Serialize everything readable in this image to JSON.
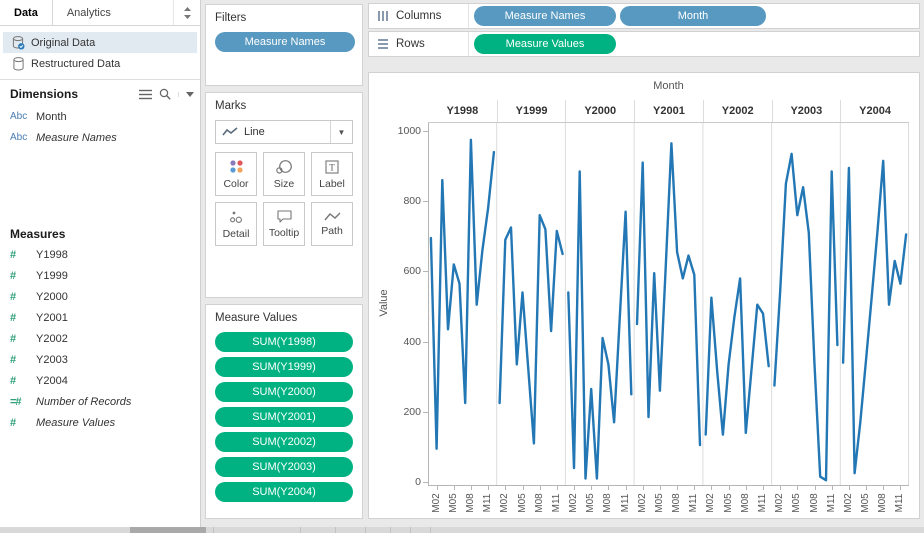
{
  "sidebar": {
    "tabs": [
      {
        "label": "Data"
      },
      {
        "label": "Analytics"
      }
    ],
    "data_sources": [
      {
        "label": "Original Data",
        "selected": true
      },
      {
        "label": "Restructured Data",
        "selected": false
      }
    ],
    "dimensions": {
      "header": "Dimensions",
      "items": [
        {
          "prefix": "Abc",
          "label": "Month",
          "italic": false
        },
        {
          "prefix": "Abc",
          "label": "Measure Names",
          "italic": true
        }
      ]
    },
    "measures": {
      "header": "Measures",
      "items": [
        {
          "icon": "#",
          "label": "Y1998",
          "italic": false
        },
        {
          "icon": "#",
          "label": "Y1999",
          "italic": false
        },
        {
          "icon": "#",
          "label": "Y2000",
          "italic": false
        },
        {
          "icon": "#",
          "label": "Y2001",
          "italic": false
        },
        {
          "icon": "#",
          "label": "Y2002",
          "italic": false
        },
        {
          "icon": "#",
          "label": "Y2003",
          "italic": false
        },
        {
          "icon": "#",
          "label": "Y2004",
          "italic": false
        },
        {
          "icon": "=#",
          "label": "Number of Records",
          "italic": true
        },
        {
          "icon": "#",
          "label": "Measure Values",
          "italic": true
        }
      ]
    }
  },
  "filters_card": {
    "title": "Filters",
    "pills": [
      "Measure Names"
    ]
  },
  "marks_card": {
    "title": "Marks",
    "mark_type": "Line",
    "buttons": [
      {
        "label": "Color"
      },
      {
        "label": "Size"
      },
      {
        "label": "Label"
      },
      {
        "label": "Detail"
      },
      {
        "label": "Tooltip"
      },
      {
        "label": "Path"
      }
    ]
  },
  "measure_values_card": {
    "title": "Measure Values",
    "pills": [
      "SUM(Y1998)",
      "SUM(Y1999)",
      "SUM(Y2000)",
      "SUM(Y2001)",
      "SUM(Y2002)",
      "SUM(Y2003)",
      "SUM(Y2004)"
    ]
  },
  "shelves": {
    "columns": {
      "label": "Columns",
      "pills": [
        "Measure Names",
        "Month"
      ]
    },
    "rows": {
      "label": "Rows",
      "pills": [
        "Measure Values"
      ]
    }
  },
  "colors": {
    "dimension_pill_blue": "#5799c0",
    "measure_pill_green": "#00b281",
    "line_blue": "#2277b4",
    "selected_row": "#e2eaf1",
    "field_number_icon_green": "#2e9e7a",
    "abc_prefix_blue": "#4a7cb0"
  },
  "chart_data": {
    "type": "line",
    "title": "Month",
    "ylabel": "Value",
    "ylim": [
      0,
      1000
    ],
    "yticks": [
      0,
      200,
      400,
      600,
      800,
      1000
    ],
    "grid": "off",
    "legend": "none",
    "line_color": "#2277b4",
    "panels": [
      "Y1998",
      "Y1999",
      "Y2000",
      "Y2001",
      "Y2002",
      "Y2003",
      "Y2004"
    ],
    "x_categories": [
      "M01",
      "M02",
      "M03",
      "M04",
      "M05",
      "M06",
      "M07",
      "M08",
      "M09",
      "M10",
      "M11",
      "M12"
    ],
    "x_tick_labels": [
      "M02",
      "M05",
      "M08",
      "M11"
    ],
    "x_tick_months": [
      2,
      5,
      8,
      11
    ],
    "series": [
      {
        "name": "Y1998",
        "values": [
          695,
          95,
          860,
          435,
          620,
          565,
          225,
          975,
          505,
          660,
          780,
          940
        ]
      },
      {
        "name": "Y1999",
        "values": [
          225,
          690,
          725,
          335,
          540,
          325,
          110,
          760,
          720,
          430,
          715,
          650
        ]
      },
      {
        "name": "Y2000",
        "values": [
          540,
          40,
          885,
          10,
          265,
          10,
          410,
          335,
          170,
          470,
          770,
          250
        ]
      },
      {
        "name": "Y2001",
        "values": [
          450,
          910,
          185,
          595,
          260,
          605,
          965,
          655,
          580,
          645,
          590,
          105
        ]
      },
      {
        "name": "Y2002",
        "values": [
          135,
          525,
          315,
          135,
          335,
          470,
          580,
          140,
          320,
          505,
          480,
          330
        ]
      },
      {
        "name": "Y2003",
        "values": [
          275,
          545,
          850,
          935,
          760,
          840,
          710,
          335,
          15,
          5,
          885,
          390
        ]
      },
      {
        "name": "Y2004",
        "values": [
          340,
          895,
          25,
          170,
          350,
          530,
          715,
          915,
          505,
          630,
          565,
          705
        ]
      }
    ]
  }
}
